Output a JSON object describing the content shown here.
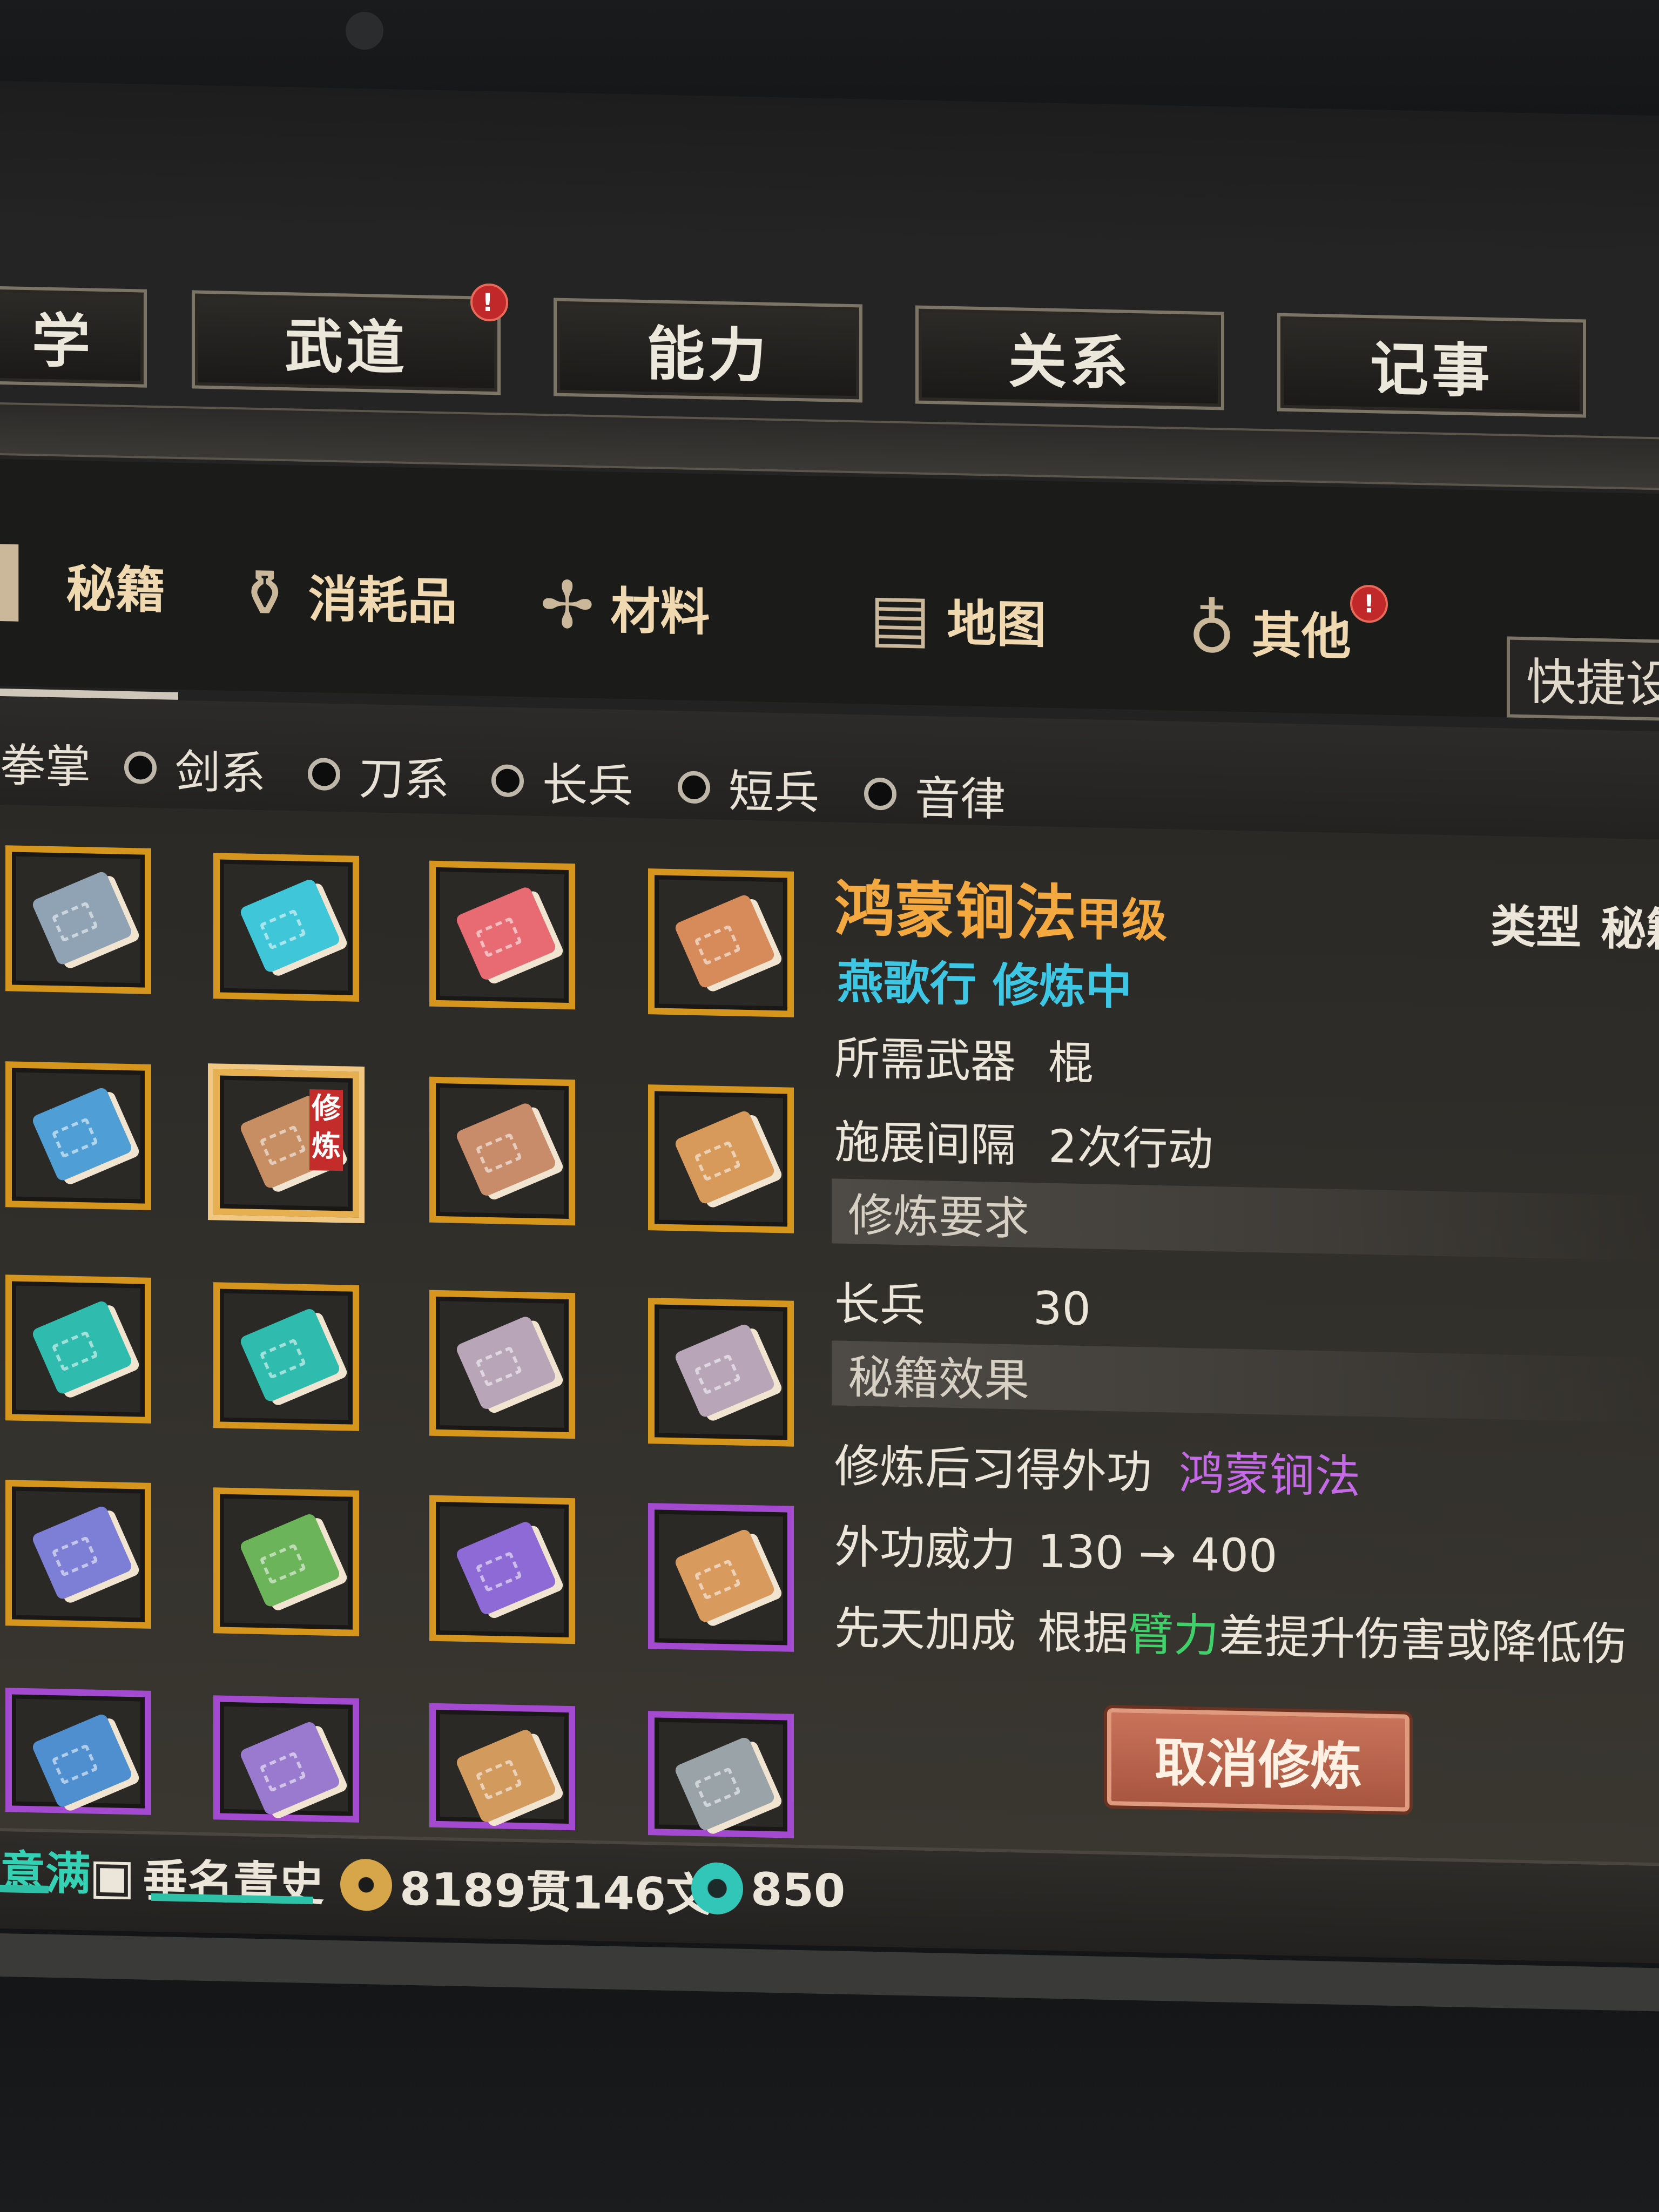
{
  "top_tabs": [
    {
      "label": "学",
      "badge": false
    },
    {
      "label": "武道",
      "badge": true
    },
    {
      "label": "能力",
      "badge": false
    },
    {
      "label": "关系",
      "badge": false
    },
    {
      "label": "记事",
      "badge": false
    }
  ],
  "badge_text": "!",
  "categories": [
    {
      "label": "秘籍",
      "icon": "bookmark-icon",
      "selected": true
    },
    {
      "label": "消耗品",
      "icon": "gourd-icon"
    },
    {
      "label": "材料",
      "icon": "herb-icon"
    },
    {
      "label": "地图",
      "icon": "map-icon"
    },
    {
      "label": "其他",
      "icon": "lantern-icon",
      "badge": true
    }
  ],
  "quick_settings_label": "快捷设",
  "filters": [
    "拳掌",
    "剑系",
    "刀系",
    "长兵",
    "短兵",
    "音律"
  ],
  "inventory": [
    {
      "color": "#8fa3b5",
      "border": "orange"
    },
    {
      "color": "#3fc6d8",
      "border": "orange"
    },
    {
      "color": "#e86b74",
      "border": "orange"
    },
    {
      "color": "#d78a5a",
      "border": "orange"
    },
    {
      "color": "#4f9fd6",
      "border": "orange"
    },
    {
      "color": "#c68e62",
      "border": "orange",
      "selected": true,
      "tag": "修炼"
    },
    {
      "color": "#c98c6a",
      "border": "orange"
    },
    {
      "color": "#d89a5a",
      "border": "orange"
    },
    {
      "color": "#2fbcae",
      "border": "orange"
    },
    {
      "color": "#2fbcae",
      "border": "orange"
    },
    {
      "color": "#b8a6b8",
      "border": "orange"
    },
    {
      "color": "#b8a6b8",
      "border": "orange"
    },
    {
      "color": "#7d7fd6",
      "border": "orange"
    },
    {
      "color": "#6cb45a",
      "border": "orange"
    },
    {
      "color": "#8d6ad6",
      "border": "orange"
    },
    {
      "color": "#d99a5e",
      "border": "purple"
    },
    {
      "color": "#4f8fd0",
      "border": "purple"
    },
    {
      "color": "#9a7acf",
      "border": "purple"
    },
    {
      "color": "#d39a5e",
      "border": "purple"
    },
    {
      "color": "#9aa3a8",
      "border": "purple"
    }
  ],
  "detail": {
    "title": "鸿蒙锏法",
    "grade": "甲级",
    "type_label": "类型",
    "type_value": "秘籍",
    "status": "燕歌行 修炼中",
    "weapon_label": "所需武器",
    "weapon_value": "棍",
    "interval_label": "施展间隔",
    "interval_value": "2次行动",
    "req_header": "修炼要求",
    "req_label": "长兵",
    "req_value": "30",
    "effect_header": "秘籍效果",
    "learn_label": "修炼后习得外功",
    "learn_value": "鸿蒙锏法",
    "power_label": "外功威力",
    "power_value": "130 → 400",
    "innate_label": "先天加成",
    "innate_prefix": "根据",
    "innate_attr": "臂力",
    "innate_suffix": "差提升伤害或降低伤",
    "cancel_button": "取消修炼"
  },
  "status_bar": {
    "mood": "意满",
    "title": "垂名青史",
    "money": "8189贯146文",
    "jade": "850"
  }
}
